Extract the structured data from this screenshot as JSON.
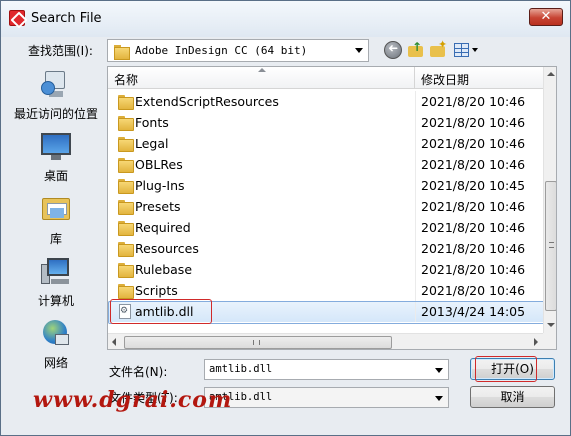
{
  "window": {
    "title": "Search File",
    "close_label": "✕"
  },
  "lookin": {
    "label": "查找范围(I):",
    "value": "Adobe InDesign CC (64 bit)"
  },
  "places": [
    {
      "label": "最近访问的位置",
      "icon": "recent-places-icon"
    },
    {
      "label": "桌面",
      "icon": "desktop-icon"
    },
    {
      "label": "库",
      "icon": "libraries-icon"
    },
    {
      "label": "计算机",
      "icon": "computer-icon"
    },
    {
      "label": "网络",
      "icon": "network-icon"
    }
  ],
  "columns": {
    "name": "名称",
    "date": "修改日期"
  },
  "rows": [
    {
      "name": "ExtendScriptResources",
      "date": "2021/8/20 10:46",
      "type": "folder"
    },
    {
      "name": "Fonts",
      "date": "2021/8/20 10:46",
      "type": "folder"
    },
    {
      "name": "Legal",
      "date": "2021/8/20 10:46",
      "type": "folder"
    },
    {
      "name": "OBLRes",
      "date": "2021/8/20 10:46",
      "type": "folder"
    },
    {
      "name": "Plug-Ins",
      "date": "2021/8/20 10:45",
      "type": "folder"
    },
    {
      "name": "Presets",
      "date": "2021/8/20 10:46",
      "type": "folder"
    },
    {
      "name": "Required",
      "date": "2021/8/20 10:46",
      "type": "folder"
    },
    {
      "name": "Resources",
      "date": "2021/8/20 10:46",
      "type": "folder"
    },
    {
      "name": "Rulebase",
      "date": "2021/8/20 10:46",
      "type": "folder"
    },
    {
      "name": "Scripts",
      "date": "2021/8/20 10:46",
      "type": "folder"
    },
    {
      "name": "amtlib.dll",
      "date": "2013/4/24 14:05",
      "type": "dll"
    }
  ],
  "filename": {
    "label": "文件名(N):",
    "value": "amtlib.dll"
  },
  "filetype": {
    "label": "文件类型(T):",
    "value": "amtlib.dll"
  },
  "buttons": {
    "open": "打开(O)",
    "cancel": "取消"
  },
  "watermark": "www.dgrai.com",
  "colors": {
    "highlight_box": "#d02a2a",
    "selection": "#d5e7fa"
  }
}
